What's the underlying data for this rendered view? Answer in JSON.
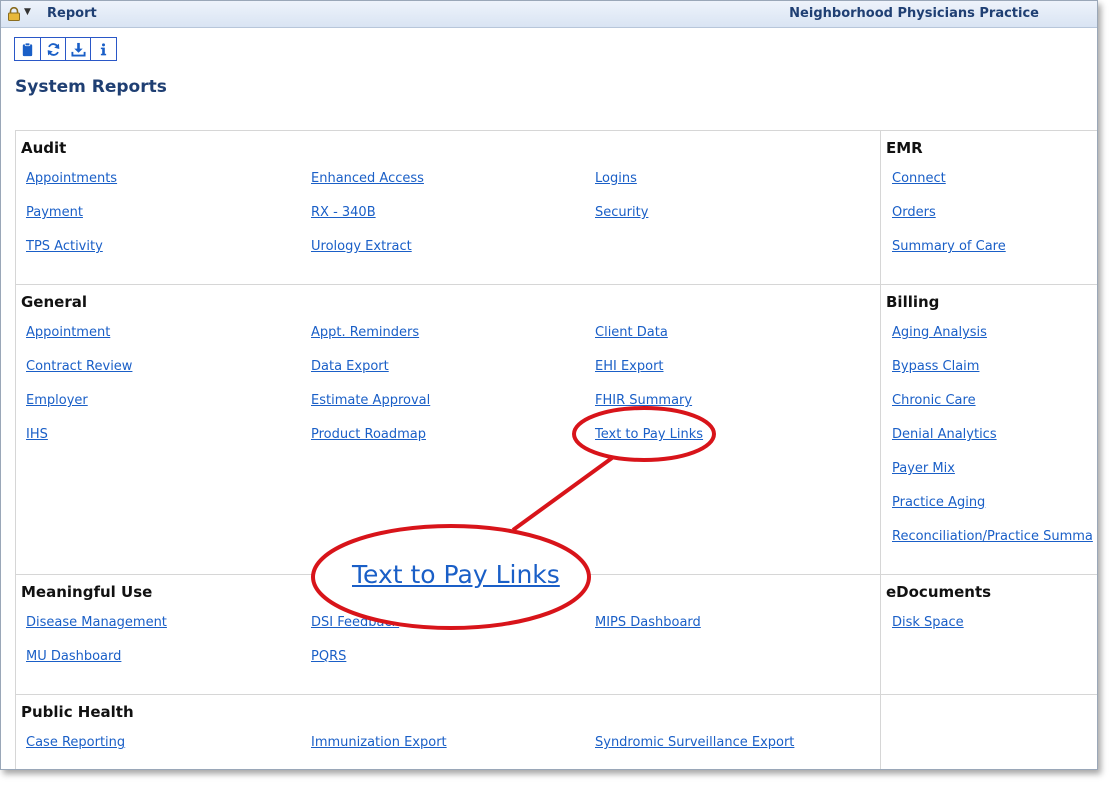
{
  "titlebar": {
    "title": "Report",
    "practice": "Neighborhood Physicians Practice"
  },
  "toolbar": {
    "icons": [
      "clipboard-icon",
      "refresh-icon",
      "download-icon",
      "info-icon"
    ]
  },
  "page_title": "System Reports",
  "sections": {
    "audit": {
      "title": "Audit",
      "links": [
        "Appointments",
        "Enhanced Access",
        "Logins",
        "Payment",
        "RX - 340B",
        "Security",
        "TPS Activity",
        "Urology Extract"
      ]
    },
    "emr": {
      "title": "EMR",
      "links": [
        "Connect",
        "Orders",
        "Summary of Care"
      ]
    },
    "general": {
      "title": "General",
      "links": [
        "Appointment",
        "Appt. Reminders",
        "Client Data",
        "Contract Review",
        "Data Export",
        "EHI Export",
        "Employer",
        "Estimate Approval",
        "FHIR Summary",
        "IHS",
        "Product Roadmap",
        "Text to Pay Links"
      ]
    },
    "billing": {
      "title": "Billing",
      "links": [
        "Aging Analysis",
        "Bypass Claim",
        "Chronic Care",
        "Denial Analytics",
        "Payer Mix",
        "Practice Aging",
        "Reconciliation/Practice Summa"
      ]
    },
    "meaningful_use": {
      "title": "Meaningful Use",
      "links": [
        "Disease Management",
        "DSI Feedback",
        "MIPS Dashboard",
        "MU Dashboard",
        "PQRS"
      ]
    },
    "edocuments": {
      "title": "eDocuments",
      "links": [
        "Disk Space"
      ]
    },
    "public_health": {
      "title": "Public Health",
      "links": [
        "Case Reporting",
        "Immunization Export",
        "Syndromic Surveillance Export"
      ]
    }
  },
  "callout": {
    "zoom_text": "Text to Pay Links",
    "color": "#d8141a"
  },
  "colors": {
    "link": "#1a5fc7",
    "heading": "#1f3f73"
  }
}
